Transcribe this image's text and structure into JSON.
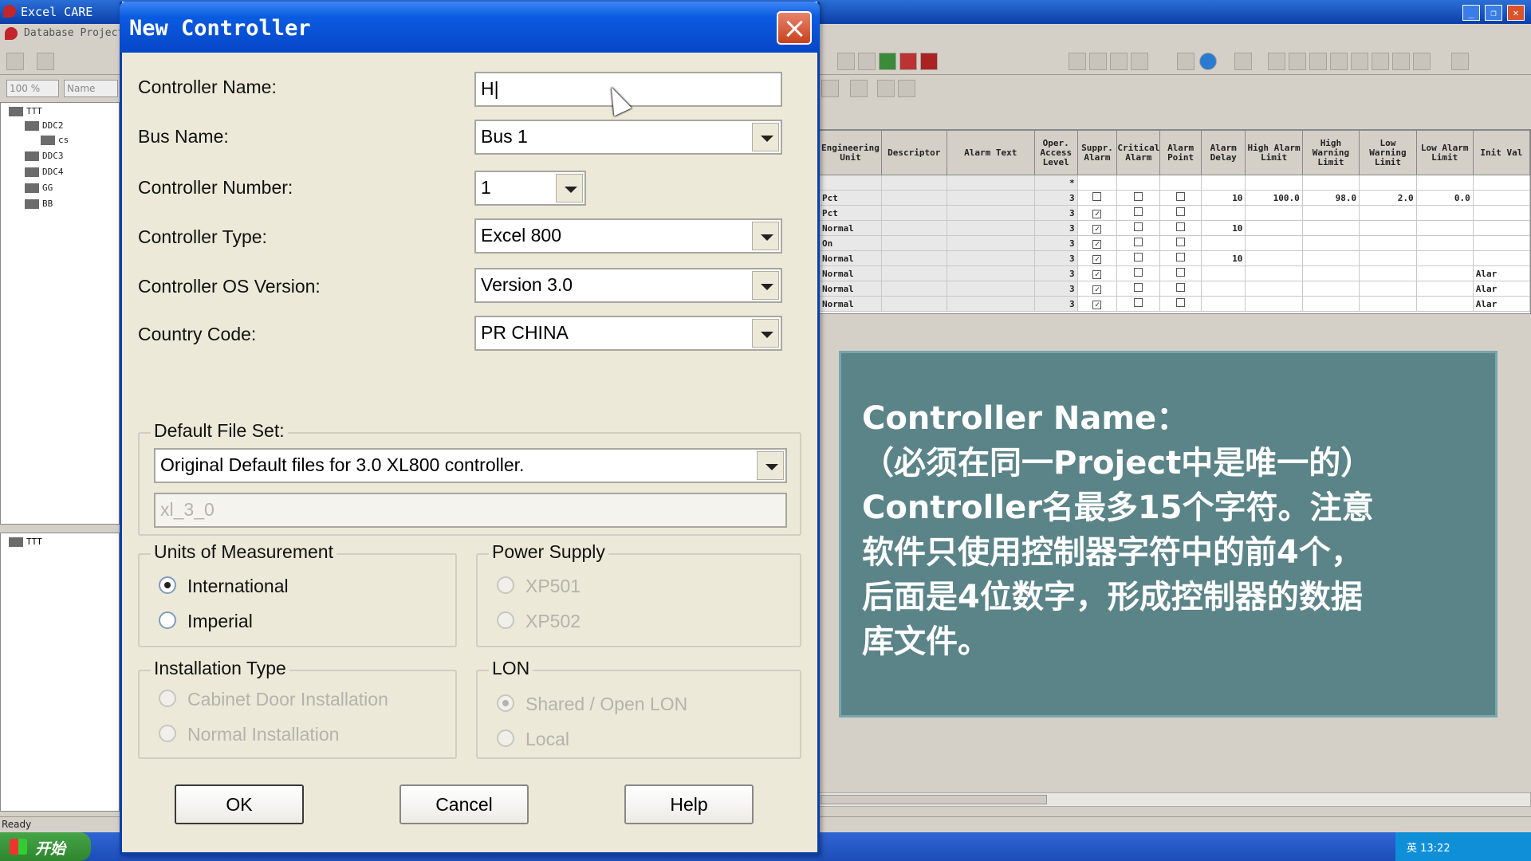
{
  "app": {
    "title": "Excel CARE",
    "menu": "Database  Project",
    "zoom": "100 %",
    "name_label": "Name",
    "status": "Ready"
  },
  "tree": {
    "items": [
      "TTT",
      "DDC2",
      "cs",
      "DDC3",
      "DDC4",
      "GG",
      "BB"
    ],
    "bottom_item": "TTT"
  },
  "grid": {
    "headers": [
      "Engineering Unit",
      "Descriptor",
      "Alarm Text",
      "Oper. Access Level",
      "Suppr. Alarm",
      "Critical Alarm",
      "Alarm Point",
      "Alarm Delay",
      "High Alarm Limit",
      "High Warning Limit",
      "Low Warning Limit",
      "Low Alarm Limit",
      "Init Val"
    ],
    "rows": [
      {
        "unit": "",
        "level": "*",
        "sup": "",
        "crit": "",
        "ap": "",
        "delay": "",
        "hal": "",
        "hwl": "",
        "lwl": "",
        "lal": "",
        "init": ""
      },
      {
        "unit": "Pct",
        "level": "3",
        "sup": "",
        "crit": "",
        "ap": "",
        "delay": "10",
        "hal": "100.0",
        "hwl": "98.0",
        "lwl": "2.0",
        "lal": "0.0",
        "init": ""
      },
      {
        "unit": "Pct",
        "level": "3",
        "sup": "✓",
        "crit": "",
        "ap": "",
        "delay": "",
        "hal": "",
        "hwl": "",
        "lwl": "",
        "lal": "",
        "init": ""
      },
      {
        "unit": "Normal",
        "level": "3",
        "sup": "✓",
        "crit": "",
        "ap": "",
        "delay": "10",
        "hal": "",
        "hwl": "",
        "lwl": "",
        "lal": "",
        "init": ""
      },
      {
        "unit": "On",
        "level": "3",
        "sup": "✓",
        "crit": "",
        "ap": "",
        "delay": "",
        "hal": "",
        "hwl": "",
        "lwl": "",
        "lal": "",
        "init": ""
      },
      {
        "unit": "Normal",
        "level": "3",
        "sup": "✓",
        "crit": "",
        "ap": "",
        "delay": "10",
        "hal": "",
        "hwl": "",
        "lwl": "",
        "lal": "",
        "init": ""
      },
      {
        "unit": "Normal",
        "level": "3",
        "sup": "✓",
        "crit": "",
        "ap": "",
        "delay": "",
        "hal": "",
        "hwl": "",
        "lwl": "",
        "lal": "",
        "init": "Alar"
      },
      {
        "unit": "Normal",
        "level": "3",
        "sup": "✓",
        "crit": "",
        "ap": "",
        "delay": "",
        "hal": "",
        "hwl": "",
        "lwl": "",
        "lal": "",
        "init": "Alar"
      },
      {
        "unit": "Normal",
        "level": "3",
        "sup": "✓",
        "crit": "",
        "ap": "",
        "delay": "",
        "hal": "",
        "hwl": "",
        "lwl": "",
        "lal": "",
        "init": "Alar"
      }
    ]
  },
  "dialog": {
    "title": "New Controller",
    "controller_name_label": "Controller Name:",
    "controller_name_value": "H|",
    "bus_name_label": "Bus Name:",
    "bus_name_value": "Bus 1",
    "controller_number_label": "Controller Number:",
    "controller_number_value": "1",
    "controller_type_label": "Controller Type:",
    "controller_type_value": "Excel 800",
    "os_version_label": "Controller OS Version:",
    "os_version_value": "Version 3.0",
    "country_code_label": "Country Code:",
    "country_code_value": "PR CHINA",
    "default_file_set_label": "Default File Set:",
    "default_file_set_value": "Original Default files for 3.0 XL800 controller.",
    "file_set_name": "xl_3_0",
    "units_label": "Units of Measurement",
    "units_international": "International",
    "units_imperial": "Imperial",
    "power_supply_label": "Power Supply",
    "power_xp501": "XP501",
    "power_xp502": "XP502",
    "installation_label": "Installation Type",
    "install_cabinet": "Cabinet Door Installation",
    "install_normal": "Normal Installation",
    "lon_label": "LON",
    "lon_shared": "Shared / Open LON",
    "lon_local": "Local",
    "ok_label": "OK",
    "cancel_label": "Cancel",
    "help_label": "Help"
  },
  "note": {
    "line1": "Controller Name：",
    "line2": "（必须在同一Project中是唯一的）",
    "line3": "Controller名最多15个字符。注意",
    "line4": "软件只使用控制器字符中的前4个，",
    "line5": "后面是4位数字，形成控制器的数据",
    "line6": "库文件。"
  },
  "taskbar": {
    "start_label": "开始",
    "tray_text": "英  13:22"
  },
  "colors": {
    "dialog_bg": "#ece9d8",
    "title_blue": "#0a5be0",
    "note_bg": "#5b8488",
    "taskbar_blue": "#1d4db8"
  }
}
